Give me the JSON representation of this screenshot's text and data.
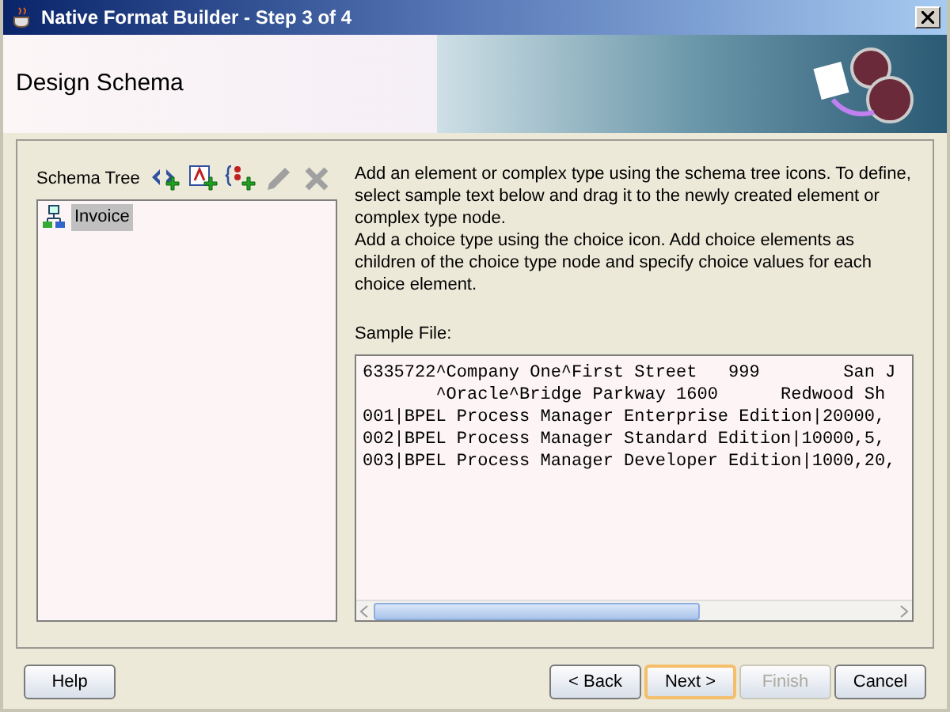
{
  "window": {
    "title": "Native Format Builder - Step 3 of 4"
  },
  "header": {
    "title": "Design Schema"
  },
  "schema_tree": {
    "label": "Schema Tree",
    "tools": [
      {
        "kind": "element",
        "disabled": false
      },
      {
        "kind": "complex",
        "disabled": false
      },
      {
        "kind": "choice",
        "disabled": false
      },
      {
        "kind": "edit",
        "disabled": true
      },
      {
        "kind": "delete",
        "disabled": true
      }
    ],
    "items": [
      {
        "label": "Invoice",
        "selected": true
      }
    ]
  },
  "instructions": [
    "Add an element or complex type using the schema tree icons. To define, select sample text below and drag it to the newly created element or complex type node.",
    "Add a choice type using the choice icon. Add choice elements as children of the choice type node and specify choice values for each choice element."
  ],
  "sample_file": {
    "label": "Sample File:",
    "lines": [
      "6335722^Company One^First Street   999        San J",
      "       ^Oracle^Bridge Parkway 1600      Redwood Sh",
      "001|BPEL Process Manager Enterprise Edition|20000,",
      "002|BPEL Process Manager Standard Edition|10000,5,",
      "003|BPEL Process Manager Developer Edition|1000,20,"
    ]
  },
  "buttons": [
    {
      "label": "Help",
      "disabled": false,
      "default": false
    },
    {
      "label": "< Back",
      "disabled": false,
      "default": false
    },
    {
      "label": "Next >",
      "disabled": false,
      "default": true
    },
    {
      "label": "Finish",
      "disabled": true,
      "default": false
    },
    {
      "label": "Cancel",
      "disabled": false,
      "default": false
    }
  ]
}
